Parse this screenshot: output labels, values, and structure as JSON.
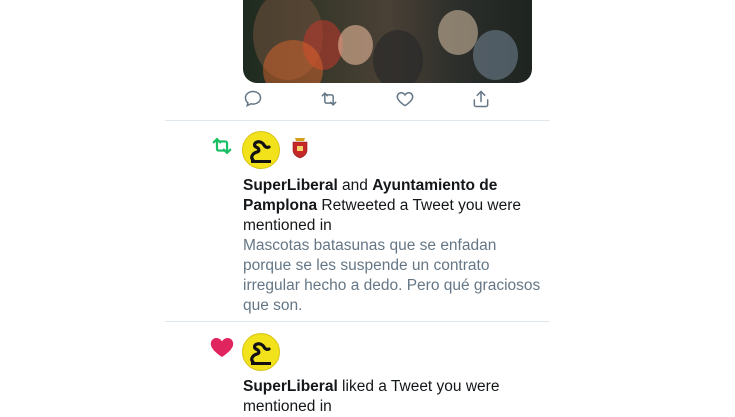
{
  "colors": {
    "retweet_green": "#17bf63",
    "like_pink": "#e0245e",
    "icon_gray": "#657786",
    "divider": "#e1e8ed",
    "avatar_yellow": "#f2e21b"
  },
  "top_tweet": {
    "media": "crowd-video-thumbnail",
    "actions": [
      {
        "name": "reply",
        "icon": "comment-icon"
      },
      {
        "name": "retweet",
        "icon": "retweet-icon"
      },
      {
        "name": "like",
        "icon": "heart-icon"
      },
      {
        "name": "share",
        "icon": "share-icon"
      }
    ]
  },
  "notifications": [
    {
      "type": "retweet",
      "icon": "retweet-icon",
      "actor1": "SuperLiberal",
      "conjunction": " and ",
      "actor2": "Ayuntamiento de Pamplona",
      "action_text": " Retweeted a Tweet you were mentioned in",
      "quote": "Mascotas batasunas que se enfadan porque se les suspende un contrato irregular hecho a dedo. Pero qué graciosos que son."
    },
    {
      "type": "like",
      "icon": "heart-icon",
      "actor1": "SuperLiberal",
      "action_text": " liked a Tweet you were mentioned in"
    }
  ]
}
